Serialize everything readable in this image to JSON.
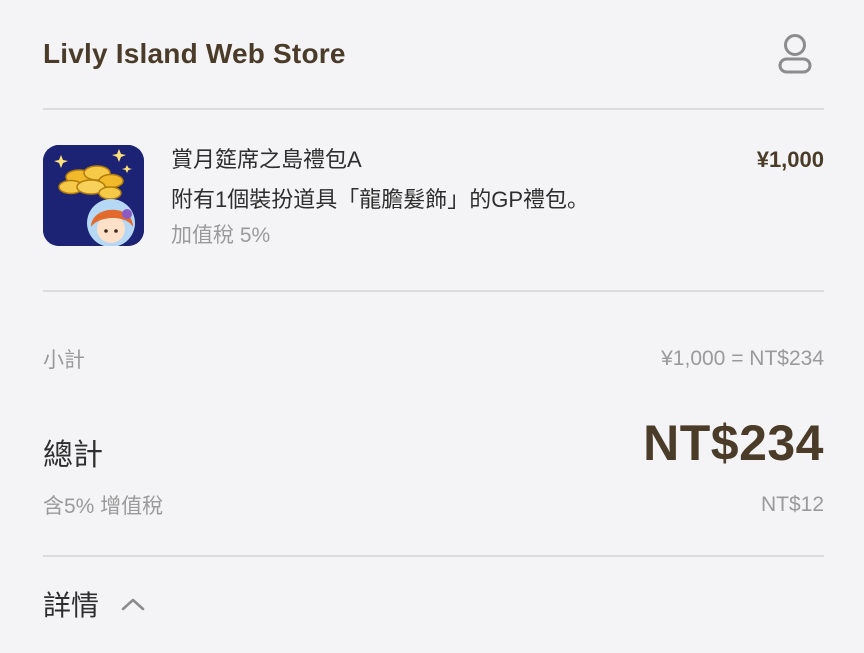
{
  "header": {
    "title": "Livly Island Web Store",
    "account_icon": "user-icon"
  },
  "product": {
    "name": "賞月筵席之島禮包A",
    "price": "¥1,000",
    "description": "附有1個裝扮道具「龍膽髮飾」的GP禮包。",
    "tax_note": "加值稅 5%",
    "thumbnail_icon": "gold-coins-character-icon"
  },
  "summary": {
    "subtotal_label": "小計",
    "subtotal_value": "¥1,000 = NT$234",
    "total_label": "總計",
    "total_value": "NT$234",
    "vat_label": "含5% 增值稅",
    "vat_value": "NT$12"
  },
  "details": {
    "label": "詳情",
    "toggle_icon": "chevron-up-icon"
  },
  "colors": {
    "brand": "#4a3c28",
    "muted": "#9a9a9a",
    "background": "#f4f4f6",
    "thumb_bg": "#1d2374"
  }
}
